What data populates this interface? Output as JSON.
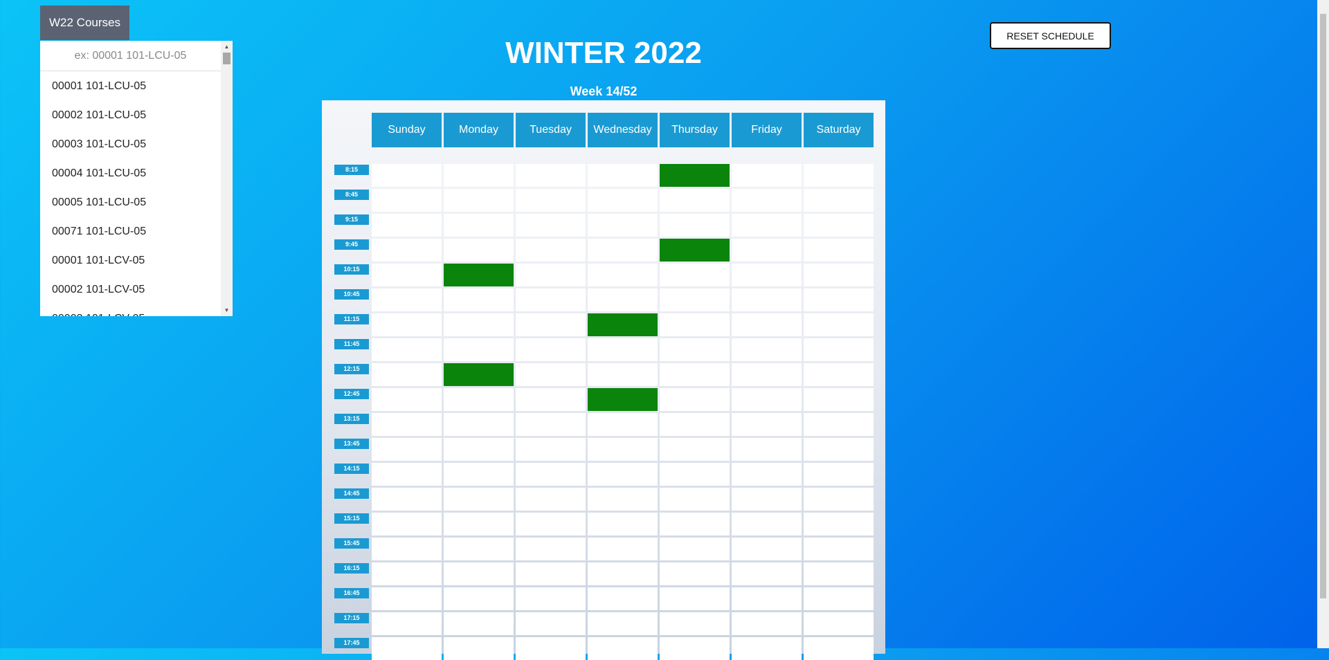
{
  "sidebar": {
    "tab_label": "W22 Courses",
    "search_placeholder": "ex: 00001 101-LCU-05",
    "courses": [
      "00001 101-LCU-05",
      "00002 101-LCU-05",
      "00003 101-LCU-05",
      "00004 101-LCU-05",
      "00005 101-LCU-05",
      "00071 101-LCU-05",
      "00001 101-LCV-05",
      "00002 101-LCV-05",
      "00003 101-LCV-05"
    ]
  },
  "header": {
    "title": "WINTER 2022",
    "week": "Week 14/52",
    "reset_label": "RESET SCHEDULE"
  },
  "schedule": {
    "days": [
      "Sunday",
      "Monday",
      "Tuesday",
      "Wednesday",
      "Thursday",
      "Friday",
      "Saturday"
    ],
    "times": [
      "8:15",
      "8:45",
      "9:15",
      "9:45",
      "10:15",
      "10:45",
      "11:15",
      "11:45",
      "12:15",
      "12:45",
      "13:15",
      "13:45",
      "14:15",
      "14:45",
      "15:15",
      "15:45",
      "16:15",
      "16:45",
      "17:15",
      "17:45"
    ],
    "booked": [
      {
        "day": "Thursday",
        "time": "8:15"
      },
      {
        "day": "Thursday",
        "time": "9:45"
      },
      {
        "day": "Monday",
        "time": "10:15"
      },
      {
        "day": "Wednesday",
        "time": "11:15"
      },
      {
        "day": "Monday",
        "time": "12:15"
      },
      {
        "day": "Wednesday",
        "time": "12:45"
      }
    ],
    "booked_color": "#0a840a",
    "header_color": "#1a9ad2"
  }
}
